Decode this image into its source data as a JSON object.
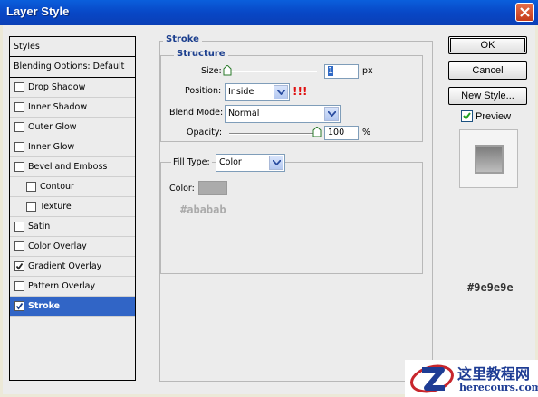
{
  "window": {
    "title": "Layer Style"
  },
  "styles": {
    "header": "Styles",
    "blending": "Blending Options: Default",
    "items": [
      {
        "label": "Drop Shadow",
        "checked": false
      },
      {
        "label": "Inner Shadow",
        "checked": false
      },
      {
        "label": "Outer Glow",
        "checked": false
      },
      {
        "label": "Inner Glow",
        "checked": false
      },
      {
        "label": "Bevel and Emboss",
        "checked": false
      },
      {
        "label": "Contour",
        "checked": false
      },
      {
        "label": "Texture",
        "checked": false
      },
      {
        "label": "Satin",
        "checked": false
      },
      {
        "label": "Color Overlay",
        "checked": false
      },
      {
        "label": "Gradient Overlay",
        "checked": true
      },
      {
        "label": "Pattern Overlay",
        "checked": false
      },
      {
        "label": "Stroke",
        "checked": true,
        "selected": true
      }
    ]
  },
  "stroke": {
    "title": "Stroke",
    "structure_title": "Structure",
    "size_label": "Size:",
    "size_value": "1",
    "size_unit": "px",
    "position_label": "Position:",
    "position_value": "Inside",
    "position_annotation": "!!!",
    "blend_label": "Blend Mode:",
    "blend_value": "Normal",
    "opacity_label": "Opacity:",
    "opacity_value": "100",
    "opacity_unit": "%",
    "opacity_level": 1.0,
    "size_level": 0.0,
    "fill_type_label": "Fill Type:",
    "fill_type_value": "Color",
    "color_label": "Color:",
    "color_swatch": "#ababab",
    "color_annotation": "#ababab"
  },
  "buttons": {
    "ok": "OK",
    "cancel": "Cancel",
    "new_style": "New Style..."
  },
  "preview": {
    "label": "Preview",
    "checked": true
  },
  "preview_annotation": "#9e9e9e",
  "watermark": {
    "line1": "这里教程网",
    "line2": "herecours.com"
  },
  "colors": {
    "titlebar": "#0a4fd0",
    "selected": "#3165c6",
    "group_title": "#1c3f8e",
    "annotation_red": "#e01010"
  }
}
